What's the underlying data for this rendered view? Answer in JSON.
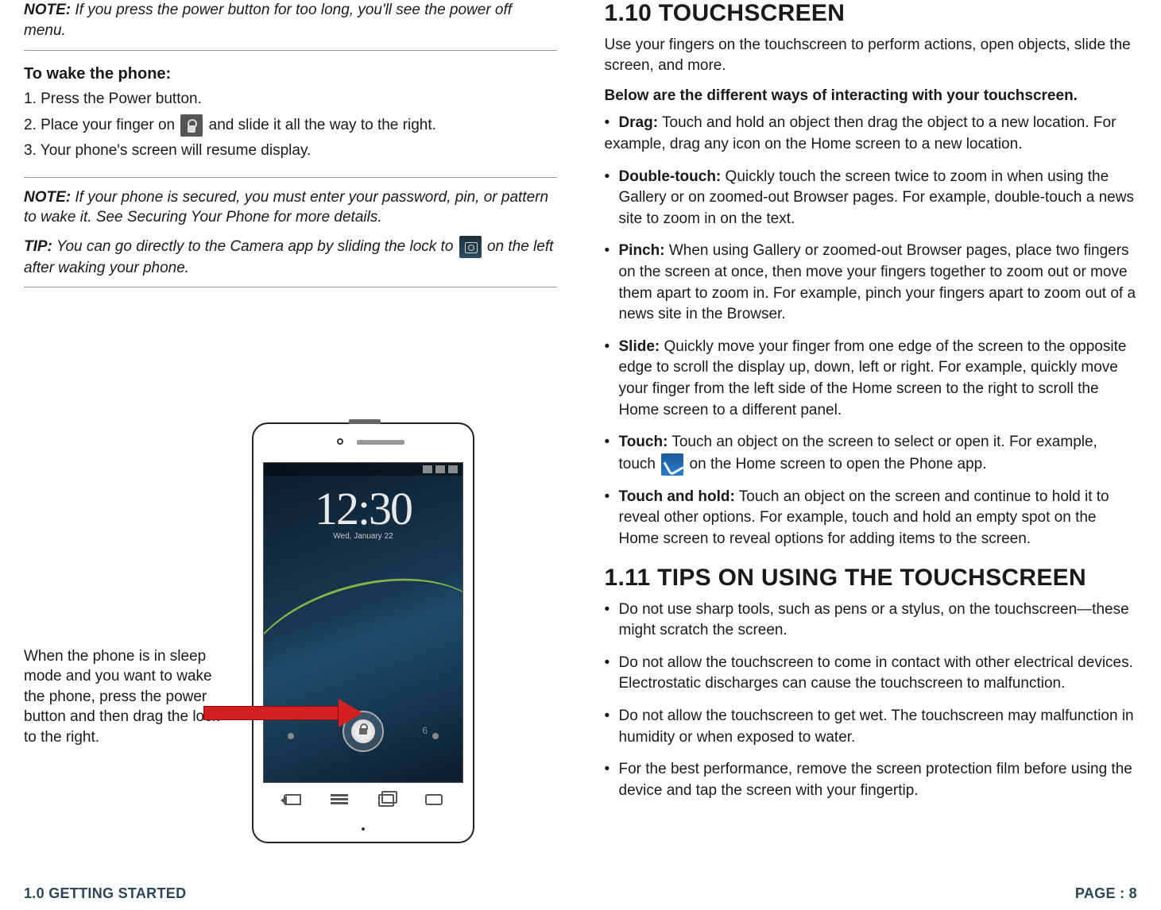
{
  "left": {
    "note1_label": "NOTE:",
    "note1_text": " If you press the power button for too long, you'll see the power off menu.",
    "wake_heading": "To wake the phone:",
    "wake_steps": {
      "s1": "1. Press the Power button.",
      "s2a": "2. Place your finger on ",
      "s2b": " and slide it all the way to the right.",
      "s3": "3. Your phone's screen will resume display."
    },
    "note2_label": "NOTE:",
    "note2_text": " If your phone is secured, you must enter your password, pin, or pattern to wake it. See Securing Your Phone for more details.",
    "tip_label": "TIP:",
    "tip_text_a": " You can go directly to the Camera app by sliding the lock to ",
    "tip_text_b": " on the left after waking your phone.",
    "sleep_caption": "When the phone is in sleep mode and you want to wake the phone, press the power button and then drag the lock to the right.",
    "clock_time": "12:30",
    "clock_date": "Wed, January 22"
  },
  "right": {
    "h_110": "1.10 TOUCHSCREEN",
    "intro": "Use your fingers on the touchscreen to perform actions, open objects, slide the screen, and more.",
    "subhead": "Below are the different ways of interacting with your touchscreen.",
    "items": {
      "drag_term": "Drag:",
      "drag_text": " Touch and hold an object then drag the object to a new location. For example, drag any icon on the Home screen to a new location.",
      "dbl_term": "Double-touch:",
      "dbl_text": " Quickly touch the screen twice to zoom in when using the Gallery or on zoomed-out Browser pages. For example, double-touch a news site to zoom in on the text.",
      "pinch_term": "Pinch:",
      "pinch_text": " When using Gallery or zoomed-out Browser pages, place two fingers on the screen at once, then move your fingers together to zoom out or move them apart to zoom in. For example, pinch your fingers apart to zoom out of a news site in the Browser.",
      "slide_term": "Slide:",
      "slide_text": " Quickly move your finger from one edge of the screen to the opposite edge to scroll the display up, down, left or right. For example, quickly move your finger from the left side of the Home screen to the right to scroll the Home screen to a different panel.",
      "touch_term": "Touch:",
      "touch_text_a": " Touch an object on the screen to select or open it. For example, touch ",
      "touch_text_b": " on the Home screen to open the Phone app.",
      "hold_term": "Touch and hold:",
      "hold_text": " Touch an object on the screen and continue to hold it to reveal other options. For example, touch and hold an empty spot on the Home screen to reveal options for adding items to the screen."
    },
    "h_111": "1.11 TIPS ON USING THE TOUCHSCREEN",
    "tips": {
      "t1": "Do not use sharp tools, such as pens or a stylus, on the touchscreen—these might scratch the screen.",
      "t2": "Do not allow the touchscreen to come in contact with other electrical devices. Electrostatic discharges can cause the touchscreen to malfunction.",
      "t3": "Do not allow the touchscreen to get wet. The touchscreen may malfunction in humidity or when exposed to water.",
      "t4": "For the best performance, remove the screen protection film before using the device and tap the screen with your fingertip."
    }
  },
  "footer": {
    "left": "1.0 GETTING STARTED",
    "right": "PAGE : 8"
  }
}
